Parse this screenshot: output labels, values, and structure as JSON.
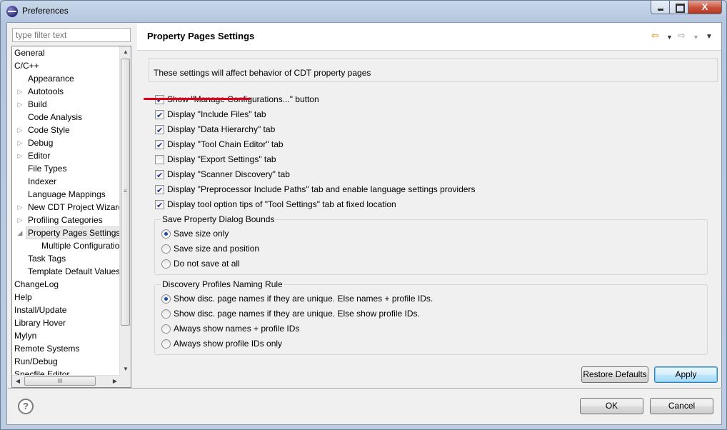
{
  "window": {
    "title": "Preferences",
    "close_glyph": "X"
  },
  "sidebar": {
    "filter_placeholder": "type filter text",
    "items": [
      {
        "label": "General",
        "level": 0,
        "arrow": ""
      },
      {
        "label": "C/C++",
        "level": 0,
        "arrow": ""
      },
      {
        "label": "Appearance",
        "level": 1,
        "arrow": ""
      },
      {
        "label": "Autotools",
        "level": 1,
        "arrow": "▷"
      },
      {
        "label": "Build",
        "level": 1,
        "arrow": "▷"
      },
      {
        "label": "Code Analysis",
        "level": 1,
        "arrow": ""
      },
      {
        "label": "Code Style",
        "level": 1,
        "arrow": "▷"
      },
      {
        "label": "Debug",
        "level": 1,
        "arrow": "▷"
      },
      {
        "label": "Editor",
        "level": 1,
        "arrow": "▷"
      },
      {
        "label": "File Types",
        "level": 1,
        "arrow": ""
      },
      {
        "label": "Indexer",
        "level": 1,
        "arrow": ""
      },
      {
        "label": "Language Mappings",
        "level": 1,
        "arrow": ""
      },
      {
        "label": "New CDT Project Wizard",
        "level": 1,
        "arrow": "▷"
      },
      {
        "label": "Profiling Categories",
        "level": 1,
        "arrow": "▷"
      },
      {
        "label": "Property Pages Settings",
        "level": 1,
        "arrow": "◢",
        "selected": true
      },
      {
        "label": "Multiple Configurations",
        "level": 2,
        "arrow": ""
      },
      {
        "label": "Task Tags",
        "level": 1,
        "arrow": ""
      },
      {
        "label": "Template Default Values",
        "level": 1,
        "arrow": ""
      },
      {
        "label": "ChangeLog",
        "level": 0,
        "arrow": ""
      },
      {
        "label": "Help",
        "level": 0,
        "arrow": ""
      },
      {
        "label": "Install/Update",
        "level": 0,
        "arrow": ""
      },
      {
        "label": "Library Hover",
        "level": 0,
        "arrow": ""
      },
      {
        "label": "Mylyn",
        "level": 0,
        "arrow": ""
      },
      {
        "label": "Remote Systems",
        "level": 0,
        "arrow": ""
      },
      {
        "label": "Run/Debug",
        "level": 0,
        "arrow": ""
      },
      {
        "label": "Specfile Editor",
        "level": 0,
        "arrow": ""
      }
    ],
    "scroll_glyphs": {
      "up": "▲",
      "down": "▼",
      "left": "◀",
      "right": "▶",
      "grip_v": "≡",
      "grip_h": "III"
    }
  },
  "page": {
    "title": "Property Pages Settings",
    "nav": {
      "back": "⇦",
      "back_dd": "▼",
      "forward": "⇨",
      "forward_dd": "▼",
      "menu": "▼"
    },
    "description": "These settings will affect behavior of CDT property pages",
    "checkboxes": [
      {
        "label": "Show \"Manage Configurations...\" button",
        "checked": true
      },
      {
        "label": "Display \"Include Files\" tab",
        "checked": true
      },
      {
        "label": "Display \"Data Hierarchy\" tab",
        "checked": true
      },
      {
        "label": "Display \"Tool Chain Editor\" tab",
        "checked": true
      },
      {
        "label": "Display \"Export Settings\" tab",
        "checked": false
      },
      {
        "label": "Display \"Scanner Discovery\" tab",
        "checked": true
      },
      {
        "label": "Display \"Preprocessor Include Paths\" tab and enable language settings providers",
        "checked": true
      },
      {
        "label": "Display tool option tips of \"Tool Settings\" tab at fixed location",
        "checked": true
      }
    ],
    "bounds_group": {
      "title": "Save Property Dialog Bounds",
      "options": [
        {
          "label": "Save size only",
          "checked": true
        },
        {
          "label": "Save size and position",
          "checked": false
        },
        {
          "label": "Do not save at all",
          "checked": false
        }
      ]
    },
    "naming_group": {
      "title": "Discovery Profiles Naming Rule",
      "options": [
        {
          "label": "Show disc. page names if they are unique. Else names + profile IDs.",
          "checked": true
        },
        {
          "label": "Show disc. page names if they are unique. Else show profile IDs.",
          "checked": false
        },
        {
          "label": "Always show names + profile IDs",
          "checked": false
        },
        {
          "label": "Always show profile IDs only",
          "checked": false
        }
      ]
    },
    "restore_defaults_label": "Restore Defaults",
    "apply_label": "Apply"
  },
  "footer": {
    "help_glyph": "?",
    "ok_label": "OK",
    "cancel_label": "Cancel"
  },
  "colors": {
    "annotation_underline": "#e0001a",
    "accent": "#3c7fb1"
  }
}
